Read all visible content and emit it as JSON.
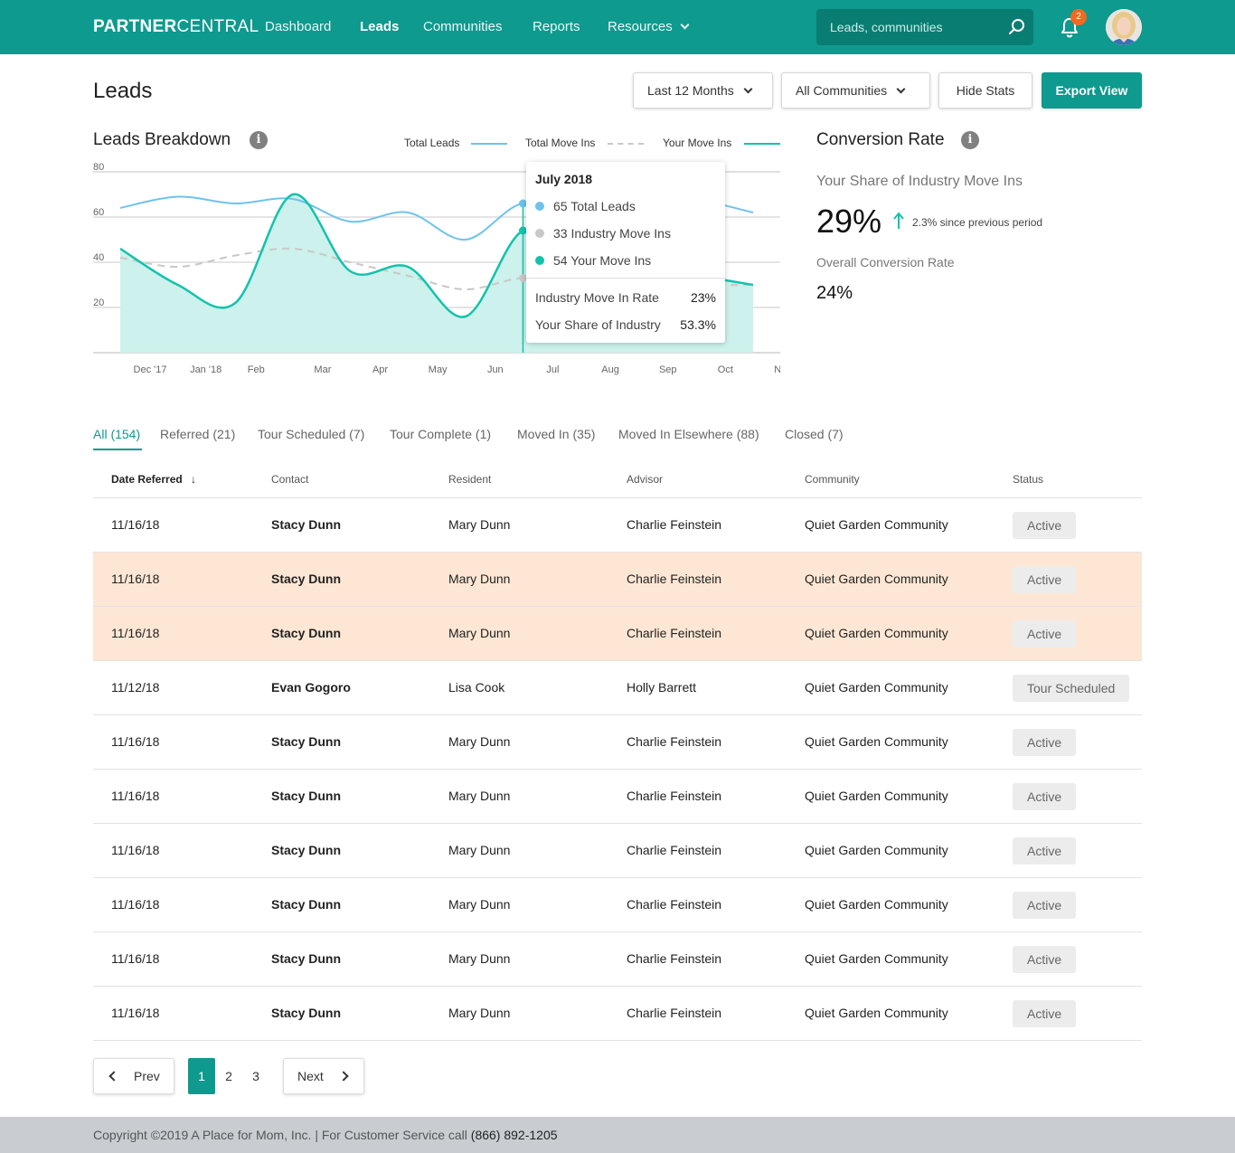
{
  "header": {
    "logo_bold": "PARTNER",
    "logo_light": "CENTRAL",
    "nav": [
      {
        "label": "Dashboard"
      },
      {
        "label": "Leads"
      },
      {
        "label": "Communities"
      },
      {
        "label": "Reports"
      },
      {
        "label": "Resources"
      }
    ],
    "search_placeholder": "Leads, communities",
    "notification_count": "2",
    "icons": {
      "search": "search-icon",
      "notifications": "bell-icon",
      "dropdown": "chevron-down-icon"
    }
  },
  "page": {
    "title": "Leads",
    "filters": {
      "period": "Last 12 Months",
      "community": "All Communities",
      "hide_stats": "Hide Stats",
      "export": "Export View"
    }
  },
  "breakdown": {
    "title": "Leads Breakdown",
    "legend": {
      "total_leads": "Total Leads",
      "total_move_ins": "Total Move Ins",
      "your_move_ins": "Your Move Ins"
    },
    "tooltip": {
      "title": "July 2018",
      "total_leads": "65 Total Leads",
      "industry_move_ins": "33 Industry Move Ins",
      "your_move_ins": "54 Your Move Ins",
      "rate_label": "Industry Move In Rate",
      "rate_value": "23%",
      "share_label": "Your Share of Industry",
      "share_value": "53.3%"
    }
  },
  "chart_data": {
    "type": "line",
    "categories": [
      "Dec '17",
      "Jan '18",
      "Feb",
      "Mar",
      "Apr",
      "May",
      "Jun",
      "Jul",
      "Aug",
      "Sep",
      "Oct",
      "Nov"
    ],
    "series": [
      {
        "name": "Total Leads",
        "values": [
          64,
          69,
          66,
          68,
          58,
          62,
          50,
          66,
          58,
          62,
          67,
          62
        ]
      },
      {
        "name": "Total Move Ins",
        "values": [
          42,
          38,
          43,
          46,
          40,
          34,
          28,
          33,
          30,
          32,
          30,
          30
        ]
      },
      {
        "name": "Your Move Ins",
        "values": [
          46,
          30,
          22,
          70,
          36,
          38,
          16,
          54,
          42,
          36,
          34,
          30
        ]
      }
    ],
    "yticks": [
      20,
      40,
      60,
      80
    ],
    "ylim": [
      0,
      80
    ],
    "highlight_category": "Jul",
    "colors": {
      "Total Leads": "#6fc3ea",
      "Total Move Ins": "#c8c8c8",
      "Your Move Ins": "#14c2ac",
      "area": "#cdf1ec"
    }
  },
  "conversion": {
    "title": "Conversion Rate",
    "share_label": "Your Share of Industry Move Ins",
    "share_value": "29%",
    "change": "2.3% since previous period",
    "overall_label": "Overall Conversion Rate",
    "overall_value": "24%"
  },
  "tabs": [
    {
      "label": "All (154)"
    },
    {
      "label": "Referred (21)"
    },
    {
      "label": "Tour Scheduled (7)"
    },
    {
      "label": "Tour Complete (1)"
    },
    {
      "label": "Moved In (35)"
    },
    {
      "label": "Moved In Elsewhere (88)"
    },
    {
      "label": "Closed (7)"
    }
  ],
  "table": {
    "headers": [
      "Date Referred",
      "Contact",
      "Resident",
      "Advisor",
      "Community",
      "Status"
    ],
    "sort_arrow": "↓",
    "rows": [
      {
        "date": "11/16/18",
        "contact": "Stacy Dunn",
        "resident": "Mary Dunn",
        "advisor": "Charlie Feinstein",
        "community": "Quiet Garden Community",
        "status": "Active"
      },
      {
        "date": "11/16/18",
        "contact": "Stacy Dunn",
        "resident": "Mary Dunn",
        "advisor": "Charlie Feinstein",
        "community": "Quiet Garden Community",
        "status": "Active"
      },
      {
        "date": "11/16/18",
        "contact": "Stacy Dunn",
        "resident": "Mary Dunn",
        "advisor": "Charlie Feinstein",
        "community": "Quiet Garden Community",
        "status": "Active"
      },
      {
        "date": "11/12/18",
        "contact": "Evan Gogoro",
        "resident": "Lisa Cook",
        "advisor": "Holly Barrett",
        "community": "Quiet Garden Community",
        "status": "Tour Scheduled"
      },
      {
        "date": "11/16/18",
        "contact": "Stacy Dunn",
        "resident": "Mary Dunn",
        "advisor": "Charlie Feinstein",
        "community": "Quiet Garden Community",
        "status": "Active"
      },
      {
        "date": "11/16/18",
        "contact": "Stacy Dunn",
        "resident": "Mary Dunn",
        "advisor": "Charlie Feinstein",
        "community": "Quiet Garden Community",
        "status": "Active"
      },
      {
        "date": "11/16/18",
        "contact": "Stacy Dunn",
        "resident": "Mary Dunn",
        "advisor": "Charlie Feinstein",
        "community": "Quiet Garden Community",
        "status": "Active"
      },
      {
        "date": "11/16/18",
        "contact": "Stacy Dunn",
        "resident": "Mary Dunn",
        "advisor": "Charlie Feinstein",
        "community": "Quiet Garden Community",
        "status": "Active"
      },
      {
        "date": "11/16/18",
        "contact": "Stacy Dunn",
        "resident": "Mary Dunn",
        "advisor": "Charlie Feinstein",
        "community": "Quiet Garden Community",
        "status": "Active"
      },
      {
        "date": "11/16/18",
        "contact": "Stacy Dunn",
        "resident": "Mary Dunn",
        "advisor": "Charlie Feinstein",
        "community": "Quiet Garden Community",
        "status": "Active"
      }
    ]
  },
  "pagination": {
    "prev": "Prev",
    "next": "Next",
    "pages": [
      "1",
      "2",
      "3"
    ]
  },
  "footer": {
    "text": "Copyright ©2019 A Place for Mom, Inc. | For Customer Service call ",
    "phone": "(866) 892-1205"
  },
  "colors": {
    "brand": "#0e9a8e",
    "highlight_row": "#fde7d4",
    "badge": "#f06b1f"
  }
}
